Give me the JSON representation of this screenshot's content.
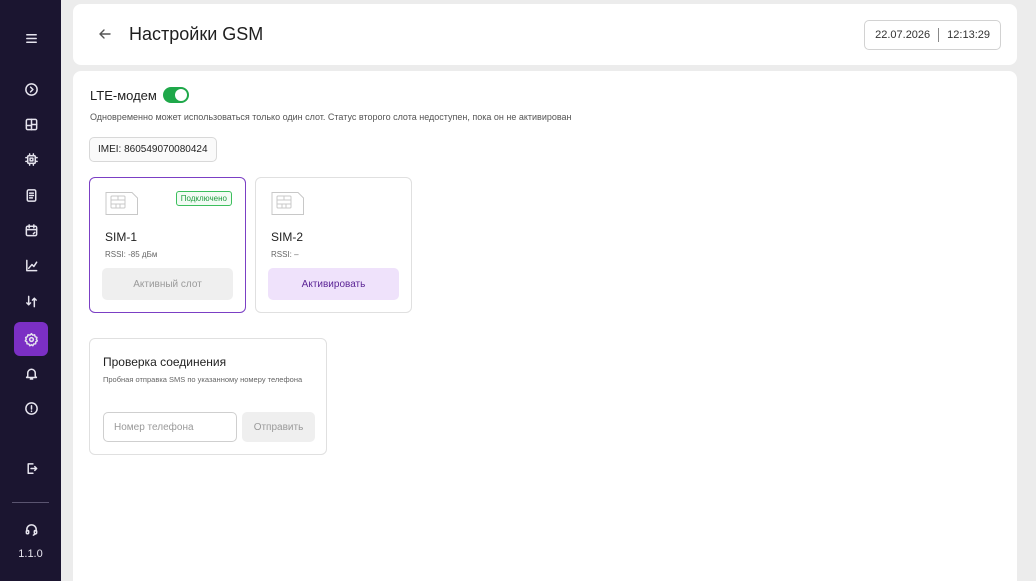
{
  "sidebar": {
    "items": [
      {
        "icon": "menu-icon",
        "active": false
      },
      {
        "icon": "circle-chevron-icon",
        "active": false
      },
      {
        "icon": "dashboard-icon",
        "active": false
      },
      {
        "icon": "chip-icon",
        "active": false
      },
      {
        "icon": "document-icon",
        "active": false
      },
      {
        "icon": "calendar-icon",
        "active": false
      },
      {
        "icon": "chart-icon",
        "active": false
      },
      {
        "icon": "transfer-icon",
        "active": false
      },
      {
        "icon": "gear-icon",
        "active": true
      },
      {
        "icon": "bell-icon",
        "active": false
      },
      {
        "icon": "alert-icon",
        "active": false
      },
      {
        "icon": "logout-icon",
        "active": false
      },
      {
        "icon": "headset-icon",
        "active": false
      }
    ],
    "version": "1.1.0",
    "active_color": "#7b2fc4"
  },
  "header": {
    "title": "Настройки GSM",
    "date": "22.07.2026",
    "time": "12:13:29"
  },
  "modem": {
    "label": "LTE-модем",
    "enabled": true,
    "toggle_color": "#1fa84a",
    "note": "Одновременно может использоваться только один слот. Статус второго слота недоступен, пока он не активирован",
    "imei": "IMEI: 860549070080424"
  },
  "sims": [
    {
      "name": "SIM-1",
      "rssi": "RSSI: -85 дБм",
      "badge": "Подключено",
      "button": "Активный слот",
      "active": true
    },
    {
      "name": "SIM-2",
      "rssi": "RSSI: –",
      "button": "Активировать",
      "active": false
    }
  ],
  "check": {
    "title": "Проверка соединения",
    "description": "Пробная отправка SMS по указанному номеру телефона",
    "phone_placeholder": "Номер телефона",
    "phone_value": "",
    "send_label": "Отправить"
  }
}
